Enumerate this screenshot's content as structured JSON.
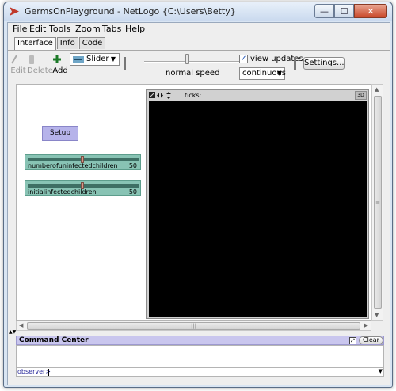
{
  "window": {
    "title": "GermsOnPlayground - NetLogo {C:\\Users\\Betty}",
    "buttons": {
      "minimize": "—",
      "maximize": "☐",
      "close": "✕"
    }
  },
  "menu": [
    "File",
    "Edit",
    "Tools",
    "Zoom",
    "Tabs",
    "Help"
  ],
  "tabs": [
    {
      "label": "Interface",
      "active": true
    },
    {
      "label": "Info",
      "active": false
    },
    {
      "label": "Code",
      "active": false
    }
  ],
  "toolbar": {
    "edit_label": "Edit",
    "delete_label": "Delete",
    "add_label": "Add",
    "widget_type": "Slider",
    "speed_label": "normal speed",
    "view_updates_label": "view updates",
    "view_updates_checked": true,
    "update_mode": "continuous",
    "settings_label": "Settings...",
    "speed_fraction": 0.5
  },
  "interface": {
    "setup_button": "Setup",
    "sliders": [
      {
        "name": "numberofuninfectedchildren",
        "value": "50",
        "fraction": 0.5
      },
      {
        "name": "initialinfectedchildren",
        "value": "50",
        "fraction": 0.5
      }
    ],
    "view": {
      "ticks_label": "ticks:",
      "three_d_label": "3D"
    }
  },
  "command_center": {
    "title": "Command Center",
    "clear_label": "Clear",
    "prompt": "observer>"
  },
  "colors": {
    "slider": "#88c3b4",
    "button": "#b6b3ea",
    "command_center": "#c9c6ee",
    "world": "#000000"
  }
}
